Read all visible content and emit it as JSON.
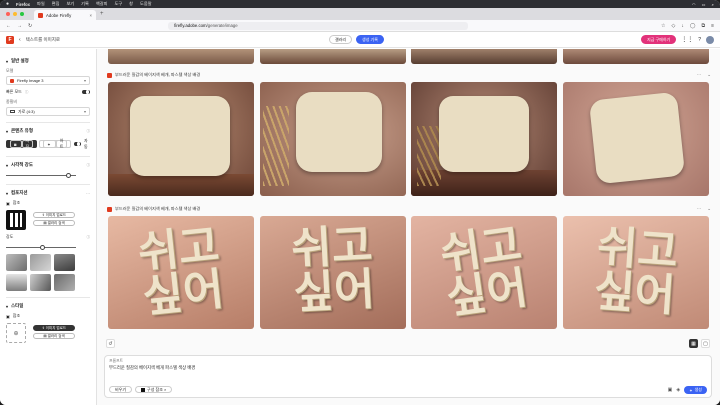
{
  "macbar": {
    "menus": [
      "Firefox",
      "파일",
      "편집",
      "보기",
      "기록",
      "책갈피",
      "도구",
      "창",
      "도움말"
    ]
  },
  "browser": {
    "tab_title": "Adobe Firefly",
    "url_host": "firefly.adobe.com",
    "url_path": "/generate/image"
  },
  "app": {
    "title": "텍스트를 이미지로",
    "center_buttons": [
      "갤러리",
      "생성 기록"
    ],
    "upgrade_label": "지금 구매하기"
  },
  "sidebar": {
    "general_header": "일반 설정",
    "model_label": "모델",
    "model_value": "Firefly Image 3",
    "fast_mode_label": "빠른 모드",
    "aspect_label": "종횡비",
    "aspect_value": "가로 (4:3)",
    "content_type_header": "콘텐츠 유형",
    "content_photo": "사진",
    "content_art": "아트",
    "content_auto": "자동",
    "visual_intensity_header": "시각적 강도",
    "composition_header": "컴포지션",
    "reference_label": "참조",
    "upload_button": "이미지 업로드",
    "gallery_button": "갤러리 검색",
    "strength_label": "강도",
    "style_header": "스타일"
  },
  "groups": [
    {
      "prompt": "부드러운 질감의 베이지색 베개, 파스텔 색상 배경"
    },
    {
      "prompt": "부드러운 질감의 베이지색 베개, 파스텔 색상 배경"
    }
  ],
  "letters": {
    "top": "쉬고",
    "bottom": "싶어"
  },
  "prompt_bar": {
    "label": "프롬프트",
    "text": "부드러운 질감의 베이지색 베개 파스텔 색상 배경",
    "chip1": "비우기",
    "chip2": "구성 참조 ×",
    "generate_label": "생성"
  },
  "colors": {
    "accent": "#3b63f3",
    "brand": "#e03a1e",
    "upgrade": "#e2327a"
  }
}
